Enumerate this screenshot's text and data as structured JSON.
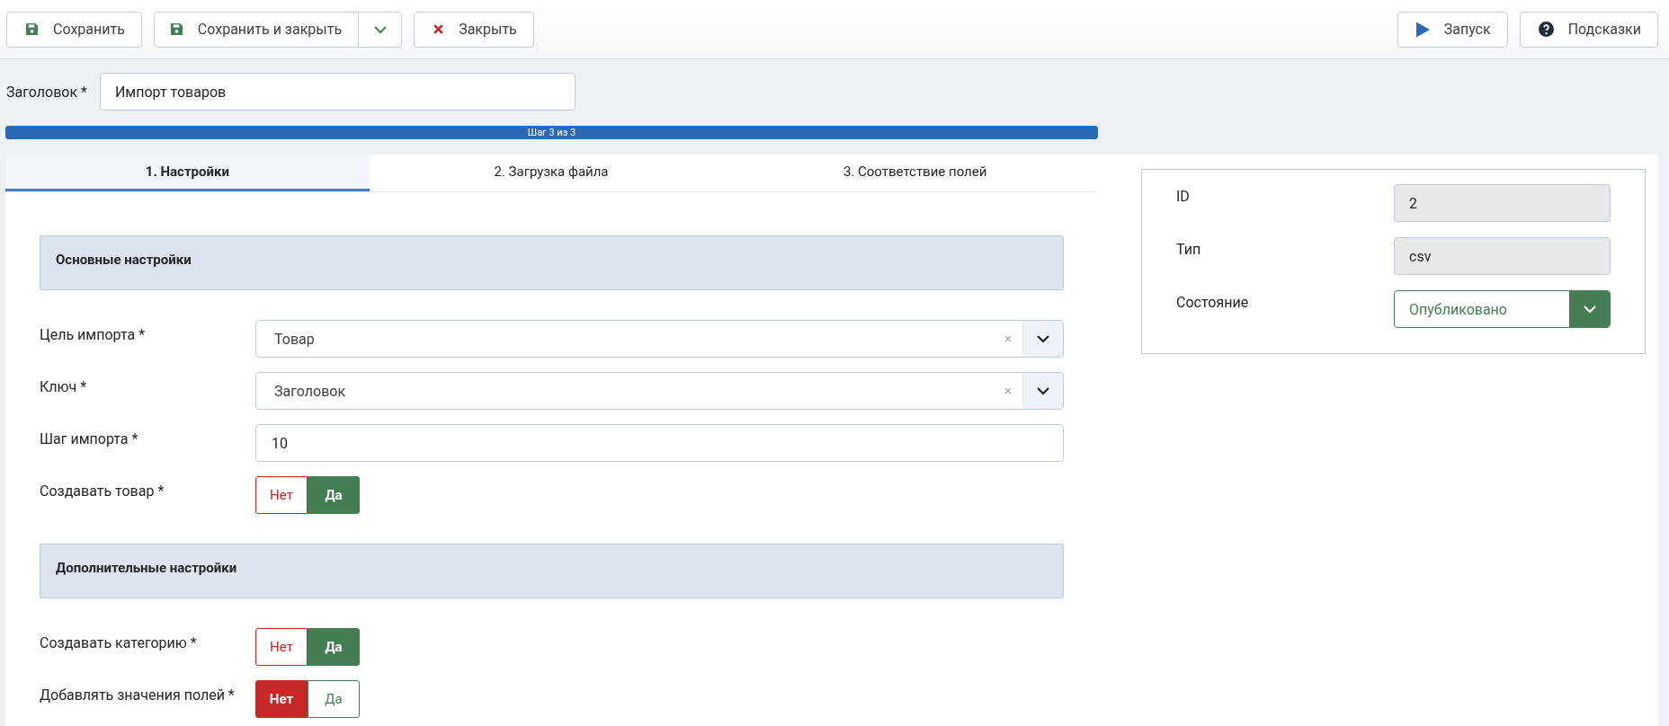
{
  "toolbar": {
    "left": [
      {
        "kind": "save",
        "label": "Сохранить"
      },
      {
        "kind": "save-split",
        "label": "Сохранить и закрыть"
      },
      {
        "kind": "close",
        "label": "Закрыть"
      }
    ],
    "right": [
      {
        "kind": "run",
        "label": "Запуск"
      },
      {
        "kind": "help",
        "label": "Подсказки"
      }
    ]
  },
  "title_field": {
    "label": "Заголовок *",
    "value": "Импорт товаров"
  },
  "progress": {
    "label": "Шаг 3 из 3",
    "level": 1
  },
  "tabs": [
    {
      "label": "1. Настройки",
      "selected": true
    },
    {
      "label": "2. Загрузка файла",
      "selected": false
    },
    {
      "label": "3. Соответствие полей",
      "selected": false
    }
  ],
  "sections": [
    {
      "title": "Основные настройки",
      "fields": [
        {
          "kind": "select",
          "label": "Цель импорта *",
          "value": "Товар"
        },
        {
          "kind": "select",
          "label": "Ключ *",
          "value": "Заголовок"
        },
        {
          "kind": "text",
          "label": "Шаг импорта *",
          "value": "10"
        },
        {
          "kind": "toggle",
          "label": "Создавать товар *",
          "options": [
            {
              "kind": "no",
              "label": "Нет",
              "selected": false
            },
            {
              "kind": "yes",
              "label": "Да",
              "selected": true
            }
          ]
        }
      ]
    },
    {
      "title": "Дополнительные настройки",
      "fields": [
        {
          "kind": "toggle",
          "label": "Создавать категорию *",
          "options": [
            {
              "kind": "no",
              "label": "Нет",
              "selected": false
            },
            {
              "kind": "yes",
              "label": "Да",
              "selected": true
            }
          ]
        },
        {
          "kind": "toggle",
          "label": "Добавлять значения полей *",
          "options": [
            {
              "kind": "no",
              "label": "Нет",
              "selected": true
            },
            {
              "kind": "yes",
              "label": "Да",
              "selected": false
            }
          ]
        }
      ]
    }
  ],
  "side": [
    {
      "kind": "readonly",
      "label": "ID",
      "value": "2"
    },
    {
      "kind": "readonly",
      "label": "Тип",
      "value": "csv"
    },
    {
      "kind": "status",
      "label": "Состояние",
      "value": "Опубликовано"
    }
  ]
}
